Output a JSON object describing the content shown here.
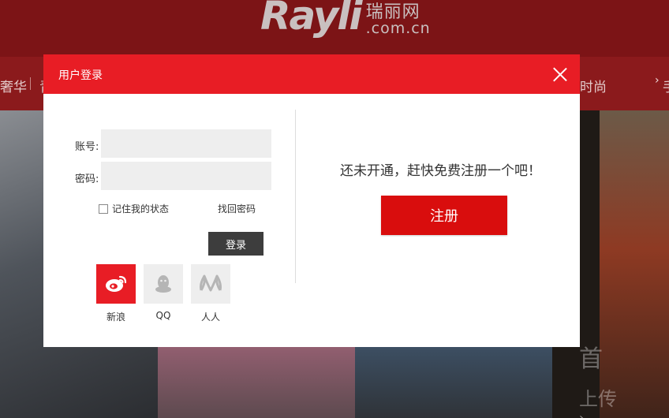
{
  "background": {
    "logo_word": "Rayli",
    "logo_cn": "瑞丽网",
    "logo_domain": ".com.cn",
    "nav_left": "奢华",
    "nav_left_partial": "青",
    "nav_right": "时尚",
    "nav_right_arrow": "›",
    "nav_right_partial": "手",
    "side_text": "首",
    "side_text2": "上传"
  },
  "modal": {
    "title": "用户登录",
    "account_label": "账号:",
    "account_value": "",
    "password_label": "密码:",
    "password_value": "",
    "remember_label": "记住我的状态",
    "forgot_label": "找回密码",
    "login_label": "登录",
    "social": [
      {
        "name": "新浪",
        "icon": "weibo-icon"
      },
      {
        "name": "QQ",
        "icon": "qq-icon"
      },
      {
        "name": "人人",
        "icon": "renren-icon"
      }
    ],
    "promo_text": "还未开通，赶快免费注册一个吧！",
    "register_label": "注册"
  },
  "colors": {
    "accent": "#e81d25",
    "register": "#d90d0d",
    "login_button": "#3d3d3d",
    "input_bg": "#eeeeee"
  }
}
